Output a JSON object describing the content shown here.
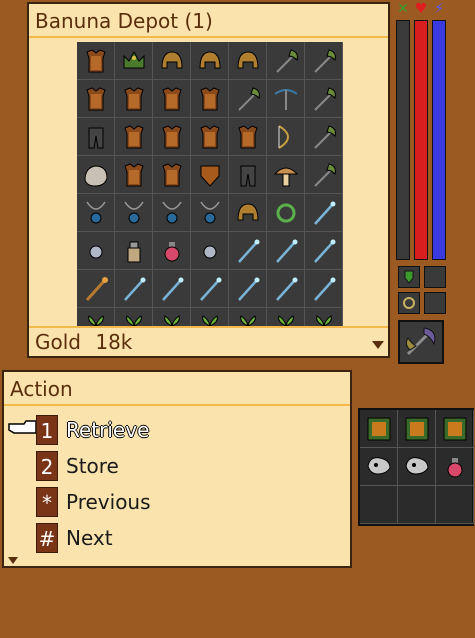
{
  "depot": {
    "title": "Banuna Depot (1)",
    "gold_label": "Gold",
    "gold_value": "18k",
    "items": [
      "armor-icon",
      "crown-icon",
      "helmet-icon",
      "helmet-icon",
      "helmet-icon",
      "axe-icon",
      "axe-icon",
      "armor-icon",
      "armor-icon",
      "armor-icon",
      "armor-icon",
      "axe-icon",
      "crossbow-icon",
      "axe-icon",
      "legs-icon",
      "armor-icon",
      "armor-icon",
      "armor-icon",
      "armor-icon",
      "bow-icon",
      "axe-icon",
      "rock-icon",
      "armor-icon",
      "armor-icon",
      "shield-icon",
      "legs-icon",
      "mushroom-icon",
      "axe-icon",
      "amulet-icon",
      "amulet-icon",
      "amulet-icon",
      "amulet-icon",
      "helmet-icon",
      "ring-icon",
      "wand-icon",
      "orb-icon",
      "bottle-icon",
      "potion-icon",
      "orb-icon",
      "wand-icon",
      "wand-icon",
      "wand-icon",
      "staff-icon",
      "wand-icon",
      "wand-icon",
      "wand-icon",
      "wand-icon",
      "wand-icon",
      "wand-icon",
      "herb-icon",
      "herb-icon",
      "herb-icon",
      "herb-icon",
      "herb-icon",
      "herb-icon",
      "herb-icon"
    ]
  },
  "stats": {
    "icons": [
      "soul-icon",
      "heart-icon",
      "mana-icon"
    ],
    "colors": {
      "soul": "#3b3b3b",
      "health": "#d81e1e",
      "mana": "#3a3ae0"
    }
  },
  "action": {
    "title": "Action",
    "items": [
      {
        "key": "1",
        "label": "Retrieve",
        "selected": true
      },
      {
        "key": "2",
        "label": "Store"
      },
      {
        "key": "*",
        "label": "Previous"
      },
      {
        "key": "#",
        "label": "Next"
      }
    ]
  },
  "backpack": {
    "items": [
      "spellbook-icon",
      "spellbook-icon",
      "spellbook-icon",
      "skull-mask-icon",
      "skull-mask-icon",
      "potion-icon"
    ]
  },
  "colors": {
    "background": "#9a5a22",
    "panel": "#fbe3ad",
    "panel_border": "#f5b84a",
    "key_bg": "#7a3416"
  }
}
